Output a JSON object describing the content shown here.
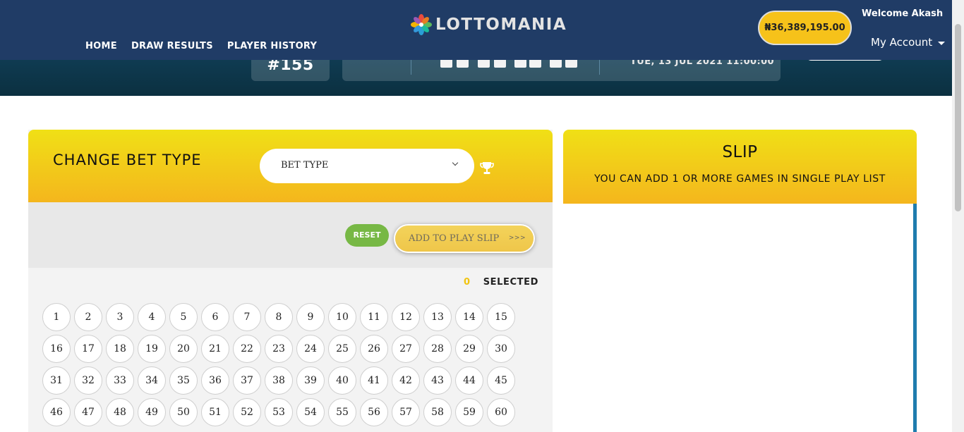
{
  "header": {
    "logo_text": "LOTTOMANIA",
    "nav": [
      "HOME",
      "DRAW RESULTS",
      "PLAYER HISTORY"
    ],
    "balance": "₦36,389,195.00",
    "welcome": "Welcome Akash",
    "account": "My Account"
  },
  "draw": {
    "id": "#155",
    "date": "TUE, 13 JUL 2021 11:00:00"
  },
  "bet": {
    "title": "CHANGE BET TYPE",
    "select_label": "BET TYPE",
    "reset_label": "RESET",
    "add_label": "ADD TO PLAY SLIP",
    "add_arrows": ">>>",
    "selected_count": "0",
    "selected_label": "SELECTED",
    "numbers": [
      1,
      2,
      3,
      4,
      5,
      6,
      7,
      8,
      9,
      10,
      11,
      12,
      13,
      14,
      15,
      16,
      17,
      18,
      19,
      20,
      21,
      22,
      23,
      24,
      25,
      26,
      27,
      28,
      29,
      30,
      31,
      32,
      33,
      34,
      35,
      36,
      37,
      38,
      39,
      40,
      41,
      42,
      43,
      44,
      45,
      46,
      47,
      48,
      49,
      50,
      51,
      52,
      53,
      54,
      55,
      56,
      57,
      58,
      59,
      60
    ]
  },
  "slip": {
    "title": "SLIP",
    "subtitle": "YOU CAN ADD 1 OR MORE GAMES IN SINGLE PLAY LIST"
  },
  "colors": {
    "header_bg": "#203c66",
    "accent_yellow": "#f4b61d",
    "reset_green": "#77b845",
    "slip_bar": "#1e7cae"
  }
}
